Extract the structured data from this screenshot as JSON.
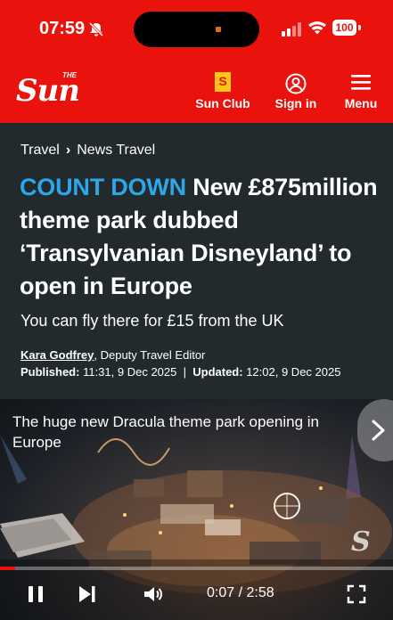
{
  "status_bar": {
    "time": "07:59",
    "battery": "100"
  },
  "header": {
    "brand_small": "THE",
    "brand": "Sun",
    "sun_club_badge": "S",
    "sun_club_label": "Sun Club",
    "sign_in_label": "Sign in",
    "menu_label": "Menu"
  },
  "breadcrumb": [
    "Travel",
    "News Travel"
  ],
  "article": {
    "kicker": "COUNT DOWN",
    "headline": "New £875million theme park dubbed ‘Transylvanian Disneyland’ to open in Europe",
    "standfirst": "You can fly there for £15 from the UK",
    "author": "Kara Godfrey",
    "author_role": ", Deputy Travel Editor",
    "published_label": "Published:",
    "published": "11:31, 9 Dec 2025",
    "updated_label": "Updated:",
    "updated": "12:02, 9 Dec 2025"
  },
  "video": {
    "title": "The huge new Dracula theme park opening in Europe",
    "current_time": "0:07",
    "duration": "2:58",
    "progress_fraction": 0.039
  },
  "colors": {
    "brand_red": "#e9120d",
    "kicker_blue": "#2ca7e8",
    "badge_yellow": "#ffc61a"
  }
}
